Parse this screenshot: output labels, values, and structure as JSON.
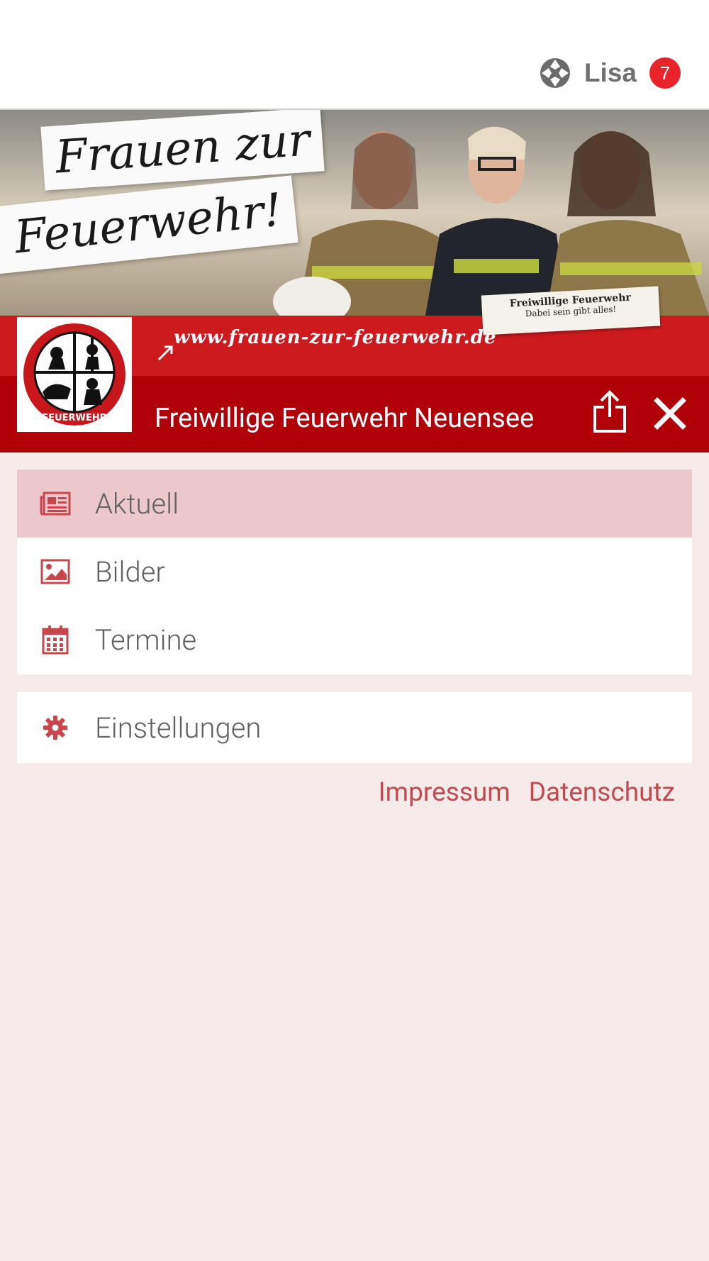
{
  "header": {
    "user_name": "Lisa",
    "notification_count": "7"
  },
  "drawer": {
    "banner": {
      "slogan_line_1": "Frauen zur",
      "slogan_line_2": "Feuerwehr!",
      "website": "www.frauen-zur-feuerwehr.de",
      "stamp_line_1": "Freiwillige Feuerwehr",
      "stamp_line_2": "Dabei sein gibt alles!"
    },
    "logo_text": "FEUERWEHR",
    "title": "Freiwillige Feuerwehr Neuensee",
    "menu": [
      {
        "label": "Aktuell",
        "icon": "newspaper-icon",
        "active": true
      },
      {
        "label": "Bilder",
        "icon": "image-icon",
        "active": false
      },
      {
        "label": "Termine",
        "icon": "calendar-icon",
        "active": false
      }
    ],
    "settings": {
      "label": "Einstellungen",
      "icon": "gear-icon"
    },
    "footer": {
      "impressum": "Impressum",
      "datenschutz": "Datenschutz"
    }
  },
  "colors": {
    "accent": "#b00008",
    "band": "#cc1a1f",
    "active_item": "#ecc8ca",
    "drawer_bg": "#f7eaeb",
    "link": "#c24a4e",
    "badge": "#e8232c"
  }
}
